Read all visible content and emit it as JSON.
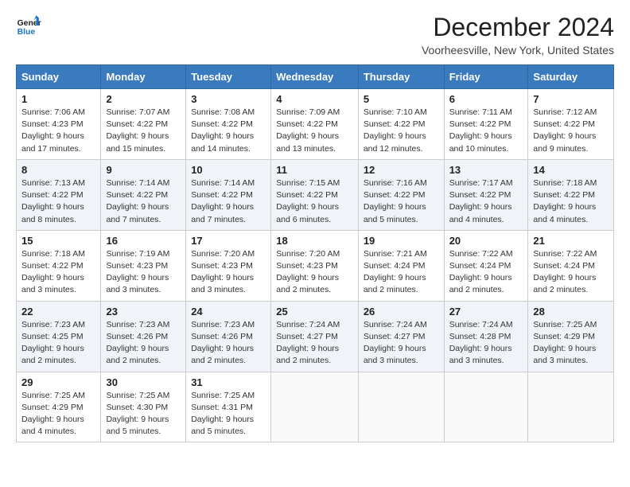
{
  "logo": {
    "line1": "General",
    "line2": "Blue"
  },
  "title": "December 2024",
  "subtitle": "Voorheesville, New York, United States",
  "header_color": "#3a7abf",
  "weekdays": [
    "Sunday",
    "Monday",
    "Tuesday",
    "Wednesday",
    "Thursday",
    "Friday",
    "Saturday"
  ],
  "weeks": [
    [
      {
        "day": "1",
        "info": "Sunrise: 7:06 AM\nSunset: 4:23 PM\nDaylight: 9 hours and 17 minutes."
      },
      {
        "day": "2",
        "info": "Sunrise: 7:07 AM\nSunset: 4:22 PM\nDaylight: 9 hours and 15 minutes."
      },
      {
        "day": "3",
        "info": "Sunrise: 7:08 AM\nSunset: 4:22 PM\nDaylight: 9 hours and 14 minutes."
      },
      {
        "day": "4",
        "info": "Sunrise: 7:09 AM\nSunset: 4:22 PM\nDaylight: 9 hours and 13 minutes."
      },
      {
        "day": "5",
        "info": "Sunrise: 7:10 AM\nSunset: 4:22 PM\nDaylight: 9 hours and 12 minutes."
      },
      {
        "day": "6",
        "info": "Sunrise: 7:11 AM\nSunset: 4:22 PM\nDaylight: 9 hours and 10 minutes."
      },
      {
        "day": "7",
        "info": "Sunrise: 7:12 AM\nSunset: 4:22 PM\nDaylight: 9 hours and 9 minutes."
      }
    ],
    [
      {
        "day": "8",
        "info": "Sunrise: 7:13 AM\nSunset: 4:22 PM\nDaylight: 9 hours and 8 minutes."
      },
      {
        "day": "9",
        "info": "Sunrise: 7:14 AM\nSunset: 4:22 PM\nDaylight: 9 hours and 7 minutes."
      },
      {
        "day": "10",
        "info": "Sunrise: 7:14 AM\nSunset: 4:22 PM\nDaylight: 9 hours and 7 minutes."
      },
      {
        "day": "11",
        "info": "Sunrise: 7:15 AM\nSunset: 4:22 PM\nDaylight: 9 hours and 6 minutes."
      },
      {
        "day": "12",
        "info": "Sunrise: 7:16 AM\nSunset: 4:22 PM\nDaylight: 9 hours and 5 minutes."
      },
      {
        "day": "13",
        "info": "Sunrise: 7:17 AM\nSunset: 4:22 PM\nDaylight: 9 hours and 4 minutes."
      },
      {
        "day": "14",
        "info": "Sunrise: 7:18 AM\nSunset: 4:22 PM\nDaylight: 9 hours and 4 minutes."
      }
    ],
    [
      {
        "day": "15",
        "info": "Sunrise: 7:18 AM\nSunset: 4:22 PM\nDaylight: 9 hours and 3 minutes."
      },
      {
        "day": "16",
        "info": "Sunrise: 7:19 AM\nSunset: 4:23 PM\nDaylight: 9 hours and 3 minutes."
      },
      {
        "day": "17",
        "info": "Sunrise: 7:20 AM\nSunset: 4:23 PM\nDaylight: 9 hours and 3 minutes."
      },
      {
        "day": "18",
        "info": "Sunrise: 7:20 AM\nSunset: 4:23 PM\nDaylight: 9 hours and 2 minutes."
      },
      {
        "day": "19",
        "info": "Sunrise: 7:21 AM\nSunset: 4:24 PM\nDaylight: 9 hours and 2 minutes."
      },
      {
        "day": "20",
        "info": "Sunrise: 7:22 AM\nSunset: 4:24 PM\nDaylight: 9 hours and 2 minutes."
      },
      {
        "day": "21",
        "info": "Sunrise: 7:22 AM\nSunset: 4:24 PM\nDaylight: 9 hours and 2 minutes."
      }
    ],
    [
      {
        "day": "22",
        "info": "Sunrise: 7:23 AM\nSunset: 4:25 PM\nDaylight: 9 hours and 2 minutes."
      },
      {
        "day": "23",
        "info": "Sunrise: 7:23 AM\nSunset: 4:26 PM\nDaylight: 9 hours and 2 minutes."
      },
      {
        "day": "24",
        "info": "Sunrise: 7:23 AM\nSunset: 4:26 PM\nDaylight: 9 hours and 2 minutes."
      },
      {
        "day": "25",
        "info": "Sunrise: 7:24 AM\nSunset: 4:27 PM\nDaylight: 9 hours and 2 minutes."
      },
      {
        "day": "26",
        "info": "Sunrise: 7:24 AM\nSunset: 4:27 PM\nDaylight: 9 hours and 3 minutes."
      },
      {
        "day": "27",
        "info": "Sunrise: 7:24 AM\nSunset: 4:28 PM\nDaylight: 9 hours and 3 minutes."
      },
      {
        "day": "28",
        "info": "Sunrise: 7:25 AM\nSunset: 4:29 PM\nDaylight: 9 hours and 3 minutes."
      }
    ],
    [
      {
        "day": "29",
        "info": "Sunrise: 7:25 AM\nSunset: 4:29 PM\nDaylight: 9 hours and 4 minutes."
      },
      {
        "day": "30",
        "info": "Sunrise: 7:25 AM\nSunset: 4:30 PM\nDaylight: 9 hours and 5 minutes."
      },
      {
        "day": "31",
        "info": "Sunrise: 7:25 AM\nSunset: 4:31 PM\nDaylight: 9 hours and 5 minutes."
      },
      null,
      null,
      null,
      null
    ]
  ]
}
